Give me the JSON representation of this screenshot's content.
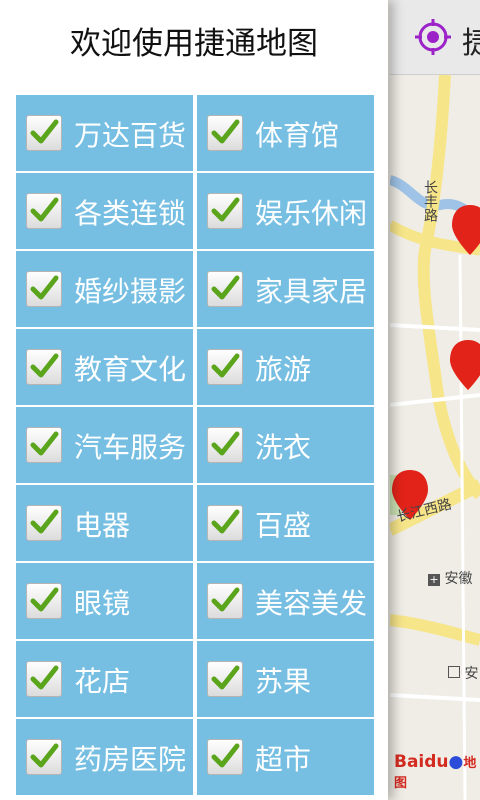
{
  "map": {
    "title": "捷",
    "labels": {
      "road_changfeng": "长丰路",
      "road_changjiang_west": "长江西路",
      "poi_anhui": "安徽",
      "poi_an": "安",
      "attribution_baidu": "Baidu",
      "attribution_map": "地图"
    }
  },
  "drawer": {
    "title": "欢迎使用捷通地图",
    "categories": [
      {
        "label": "万达百货",
        "checked": true
      },
      {
        "label": "体育馆",
        "checked": true
      },
      {
        "label": "各类连锁",
        "checked": true
      },
      {
        "label": "娱乐休闲",
        "checked": true
      },
      {
        "label": "婚纱摄影",
        "checked": true
      },
      {
        "label": "家具家居",
        "checked": true
      },
      {
        "label": "教育文化",
        "checked": true
      },
      {
        "label": "旅游",
        "checked": true
      },
      {
        "label": "汽车服务",
        "checked": true
      },
      {
        "label": "洗衣",
        "checked": true
      },
      {
        "label": "电器",
        "checked": true
      },
      {
        "label": "百盛",
        "checked": true
      },
      {
        "label": "眼镜",
        "checked": true
      },
      {
        "label": "美容美发",
        "checked": true
      },
      {
        "label": "花店",
        "checked": true
      },
      {
        "label": "苏果",
        "checked": true
      },
      {
        "label": "药房医院",
        "checked": true
      },
      {
        "label": "超市",
        "checked": true
      }
    ]
  },
  "colors": {
    "cell_bg": "#76bfe3",
    "check_green": "#5aa51c",
    "target_purple": "#9b23c8",
    "marker_red": "#e2231a"
  }
}
